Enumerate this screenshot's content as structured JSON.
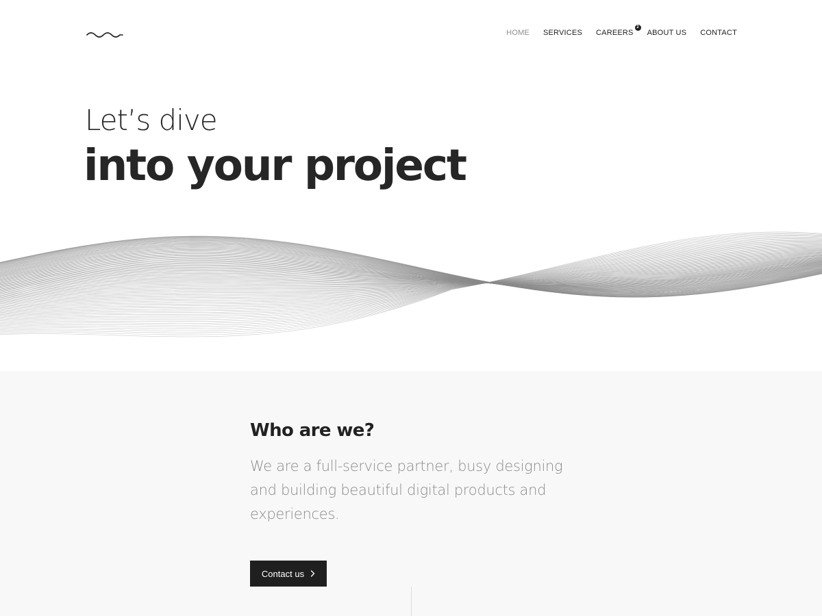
{
  "header": {
    "logo": "wave-logo",
    "nav": [
      {
        "label": "HOME",
        "active": true
      },
      {
        "label": "SERVICES",
        "active": false
      },
      {
        "label": "CAREERS",
        "active": false,
        "badge": "2"
      },
      {
        "label": "ABOUT US",
        "active": false
      },
      {
        "label": "CONTACT",
        "active": false
      }
    ]
  },
  "hero": {
    "line1": "Let’s dive",
    "line2": "into your project"
  },
  "about": {
    "title": "Who are we?",
    "text": "We are a full-service partner, busy designing and building beautiful digital products and experiences.",
    "button_label": "Contact us",
    "button_icon": "chevron-right-icon"
  },
  "colors": {
    "text_dark": "#1f1f1f",
    "nav_active": "#8d8d8d",
    "body_text": "#8b8b8b",
    "section_bg": "#f8f8f8",
    "wave": "#8a8a8a"
  }
}
